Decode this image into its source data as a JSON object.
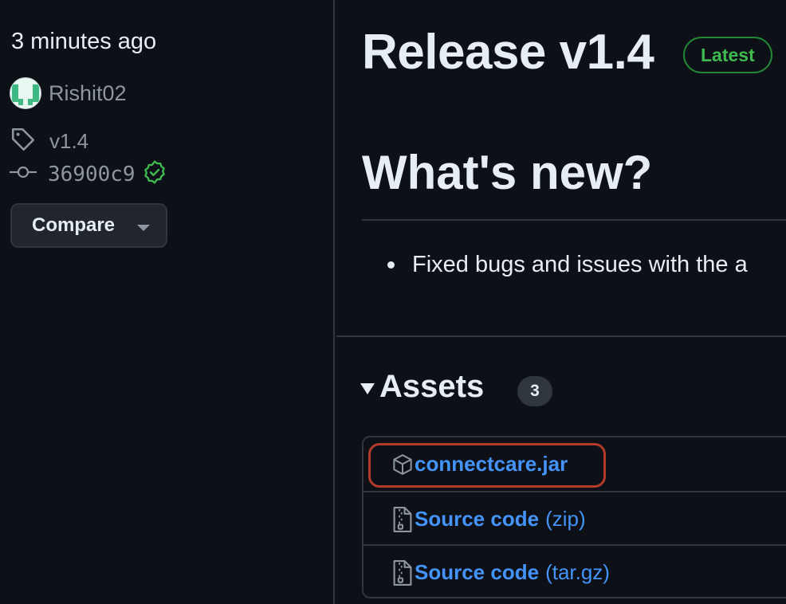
{
  "sidebar": {
    "time": "3 minutes ago",
    "author": "Rishit02",
    "tag": "v1.4",
    "commit": "36900c9",
    "compare_label": "Compare"
  },
  "release": {
    "title": "Release v1.4",
    "badge": "Latest",
    "heading": "What's new?",
    "bullets": [
      "Fixed bugs and issues with the a"
    ]
  },
  "assets": {
    "title": "Assets",
    "count": "3",
    "items": [
      {
        "name": "connectcare.jar",
        "suffix": "",
        "icon": "package-icon"
      },
      {
        "name": "Source code",
        "suffix": "(zip)",
        "icon": "file-zip-icon"
      },
      {
        "name": "Source code",
        "suffix": "(tar.gz)",
        "icon": "file-zip-icon"
      }
    ]
  },
  "colors": {
    "background": "#0d1117",
    "link": "#4493f8",
    "latest_badge": "#3fb950",
    "highlight_box": "#b13a2a"
  }
}
